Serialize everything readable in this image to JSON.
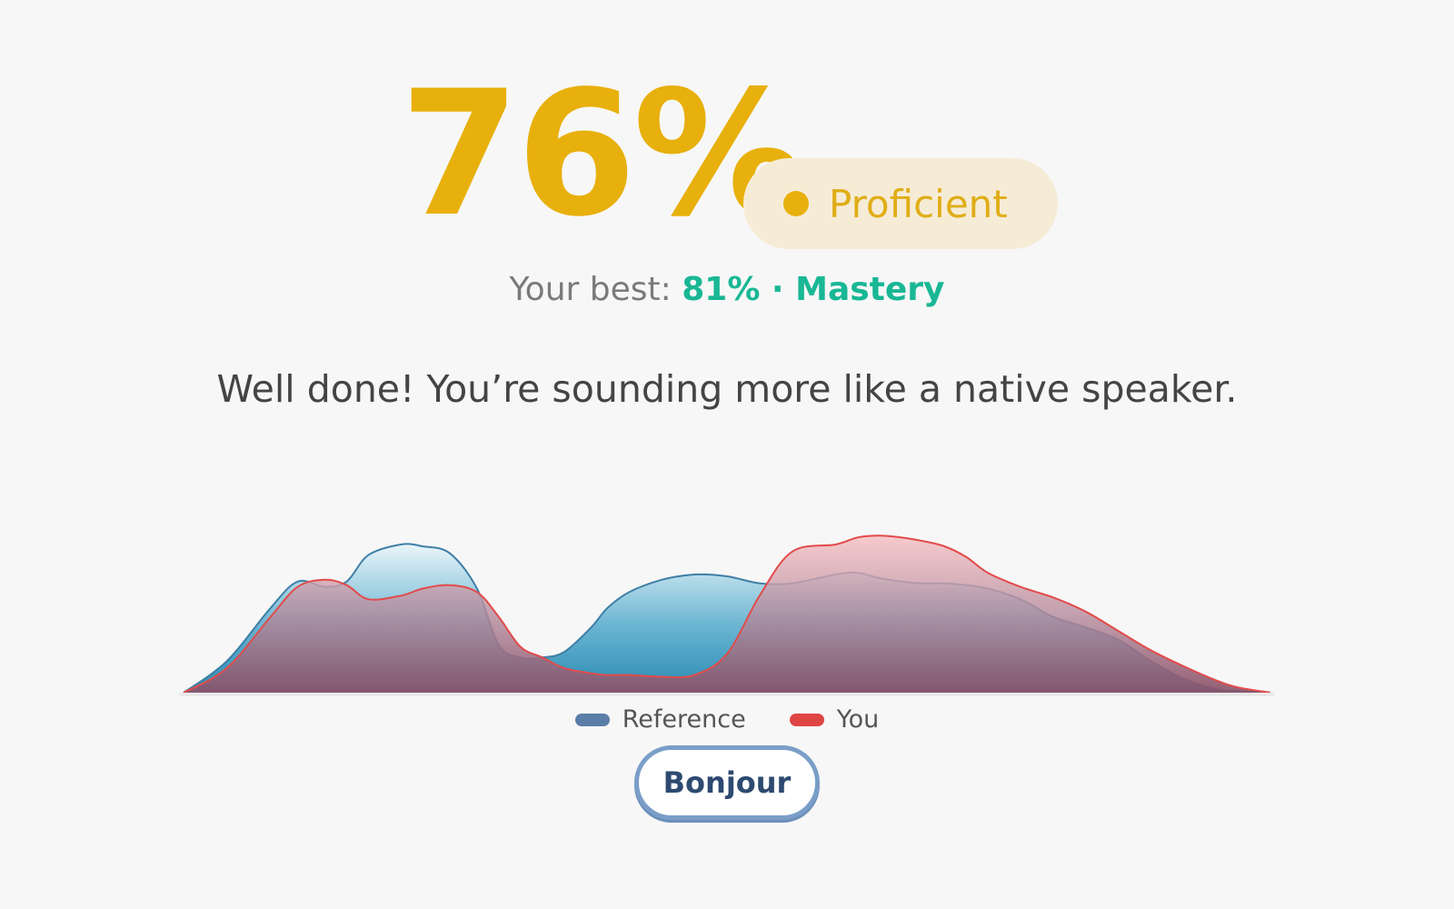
{
  "score": {
    "value": "76%",
    "level_label": "Proficient",
    "color": "#e8b00c"
  },
  "best": {
    "prefix": "Your best: ",
    "value": "81% · Mastery",
    "color": "#19b795"
  },
  "feedback": "Well done! You’re sounding more like a native speaker.",
  "chart_data": {
    "type": "area",
    "x": [
      0,
      0.04,
      0.08,
      0.105,
      0.13,
      0.15,
      0.17,
      0.2,
      0.22,
      0.245,
      0.27,
      0.29,
      0.31,
      0.33,
      0.35,
      0.375,
      0.39,
      0.41,
      0.44,
      0.47,
      0.5,
      0.53,
      0.56,
      0.6,
      0.62,
      0.64,
      0.66,
      0.68,
      0.7,
      0.72,
      0.74,
      0.77,
      0.8,
      0.83,
      0.86,
      0.89,
      0.92,
      0.95,
      0.97,
      1.0
    ],
    "series": [
      {
        "name": "Reference",
        "color": "#3f7fa6",
        "values": [
          0,
          0.18,
          0.48,
          0.63,
          0.6,
          0.63,
          0.78,
          0.84,
          0.83,
          0.79,
          0.59,
          0.27,
          0.2,
          0.2,
          0.23,
          0.37,
          0.48,
          0.57,
          0.64,
          0.67,
          0.66,
          0.62,
          0.62,
          0.67,
          0.68,
          0.65,
          0.63,
          0.62,
          0.62,
          0.61,
          0.59,
          0.53,
          0.43,
          0.37,
          0.3,
          0.18,
          0.08,
          0.02,
          0.01,
          0
        ]
      },
      {
        "name": "You",
        "color": "#e24b4b",
        "values": [
          0,
          0.14,
          0.43,
          0.6,
          0.64,
          0.61,
          0.53,
          0.55,
          0.59,
          0.61,
          0.57,
          0.43,
          0.26,
          0.2,
          0.14,
          0.11,
          0.1,
          0.1,
          0.09,
          0.1,
          0.22,
          0.55,
          0.8,
          0.84,
          0.88,
          0.89,
          0.88,
          0.86,
          0.83,
          0.77,
          0.68,
          0.6,
          0.54,
          0.46,
          0.35,
          0.24,
          0.15,
          0.07,
          0.03,
          0
        ]
      }
    ],
    "ylim": [
      0,
      1
    ],
    "grid": false,
    "legend_position": "bottom-center"
  },
  "legend": {
    "reference_label": "Reference",
    "you_label": "You",
    "reference_color": "#5b7ea8",
    "you_color": "#e04545"
  },
  "phrase_button": {
    "label": "Bonjour"
  }
}
